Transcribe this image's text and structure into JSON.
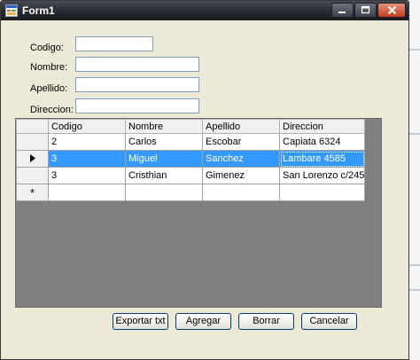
{
  "window": {
    "title": "Form1"
  },
  "form": {
    "codigo": {
      "label": "Codigo:",
      "value": ""
    },
    "nombre": {
      "label": "Nombre:",
      "value": ""
    },
    "apellido": {
      "label": "Apellido:",
      "value": ""
    },
    "direccion": {
      "label": "Direccion:",
      "value": ""
    }
  },
  "grid": {
    "columns": [
      "Codigo",
      "Nombre",
      "Apellido",
      "Direccion"
    ],
    "rows": [
      [
        "2",
        "Carlos",
        "Escobar",
        "Capiata 6324"
      ],
      [
        "3",
        "Miguel",
        "Sanchez",
        "Lambare 4585"
      ],
      [
        "3",
        "Cristhian",
        "Gimenez",
        "San Lorenzo c/245"
      ]
    ],
    "selected_row_index": 1,
    "new_row_marker": "*"
  },
  "buttons": {
    "export": "Exportar txt",
    "add": "Agregar",
    "delete": "Borrar",
    "cancel": "Cancelar"
  },
  "colors": {
    "selection": "#3399ff",
    "grid_background": "#808080",
    "form_background": "#ece9d8"
  }
}
